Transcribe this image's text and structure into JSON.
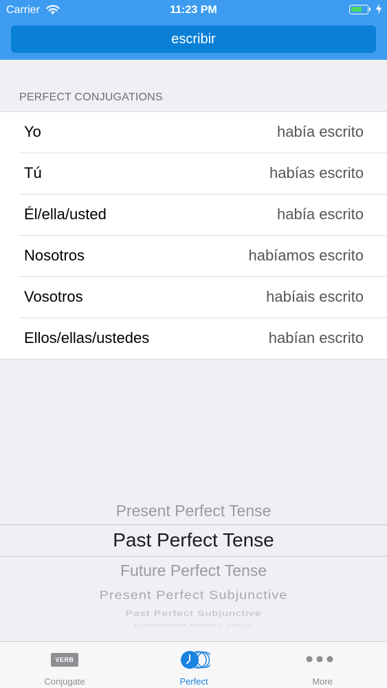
{
  "status_bar": {
    "carrier": "Carrier",
    "time": "11:23 PM",
    "battery_level": 0.7
  },
  "header": {
    "verb": "escribir"
  },
  "section": {
    "title": "PERFECT CONJUGATIONS"
  },
  "conjugations": [
    {
      "pronoun": "Yo",
      "form": "había escrito"
    },
    {
      "pronoun": "Tú",
      "form": "habías escrito"
    },
    {
      "pronoun": "Él/ella/usted",
      "form": "había escrito"
    },
    {
      "pronoun": "Nosotros",
      "form": "habíamos escrito"
    },
    {
      "pronoun": "Vosotros",
      "form": "habíais escrito"
    },
    {
      "pronoun": "Ellos/ellas/ustedes",
      "form": "habían escrito"
    }
  ],
  "tense_picker": {
    "options": [
      "Present Perfect Tense",
      "Past Perfect Tense",
      "Future Perfect Tense",
      "Present Perfect Subjunctive",
      "Past Perfect Subjunctive",
      "Conditional Perfect Tense"
    ],
    "selected": "Past Perfect Tense"
  },
  "tab_bar": {
    "tabs": [
      {
        "label": "Conjugate",
        "icon": "verb-icon",
        "icon_text": "VERB"
      },
      {
        "label": "Perfect",
        "icon": "perfect-icon"
      },
      {
        "label": "More",
        "icon": "more-icon"
      }
    ],
    "active": "Perfect"
  },
  "colors": {
    "header": "#3d9cf0",
    "verb_button": "#0a7fd6",
    "active_tab": "#1a82e0",
    "inactive_tab": "#8e8e93",
    "background": "#efeff4"
  }
}
